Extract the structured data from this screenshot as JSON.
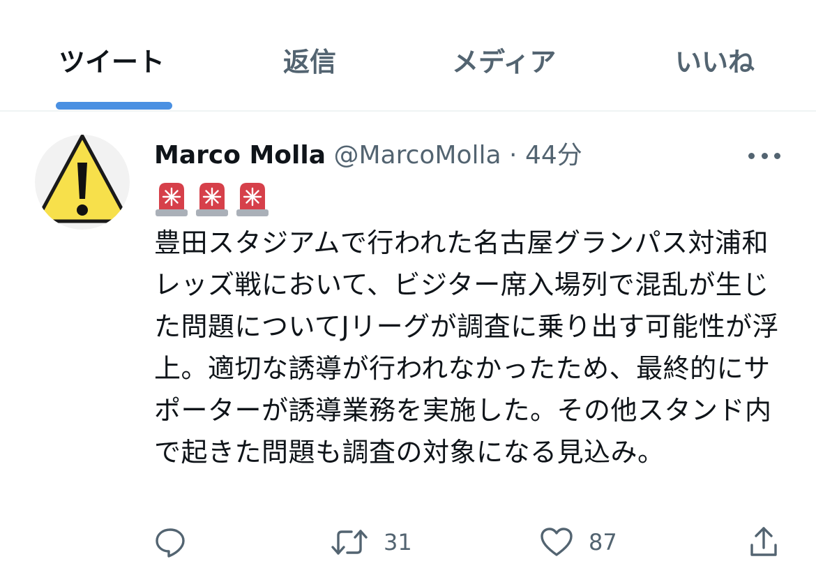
{
  "tabs": [
    {
      "label": "ツイート",
      "active": true
    },
    {
      "label": "返信",
      "active": false
    },
    {
      "label": "メディア",
      "active": false
    },
    {
      "label": "いいね",
      "active": false
    }
  ],
  "tweet": {
    "author_name": "Marco Molla",
    "author_handle": "@MarcoMolla",
    "separator": "·",
    "time": "44分",
    "avatar_icon": "warning-sign-icon",
    "emoji_icons": [
      "police-car-light-icon",
      "police-car-light-icon",
      "police-car-light-icon"
    ],
    "text": "豊田スタジアムで行われた名古屋グランパス対浦和レッズ戦において、ビジター席入場列で混乱が生じた問題についてJリーグが調査に乗り出す可能性が浮上。適切な誘導が行われなかったため、最終的にサポーターが誘導業務を実施した。その他スタンド内で起きた問題も調査の対象になる見込み。",
    "actions": {
      "reply_count": "",
      "retweet_count": "31",
      "like_count": "87"
    }
  },
  "colors": {
    "text_primary": "#0f1419",
    "text_secondary": "#536471",
    "accent": "#4a90e2",
    "warning_yellow": "#f7e04b",
    "siren_red": "#d6404a"
  }
}
